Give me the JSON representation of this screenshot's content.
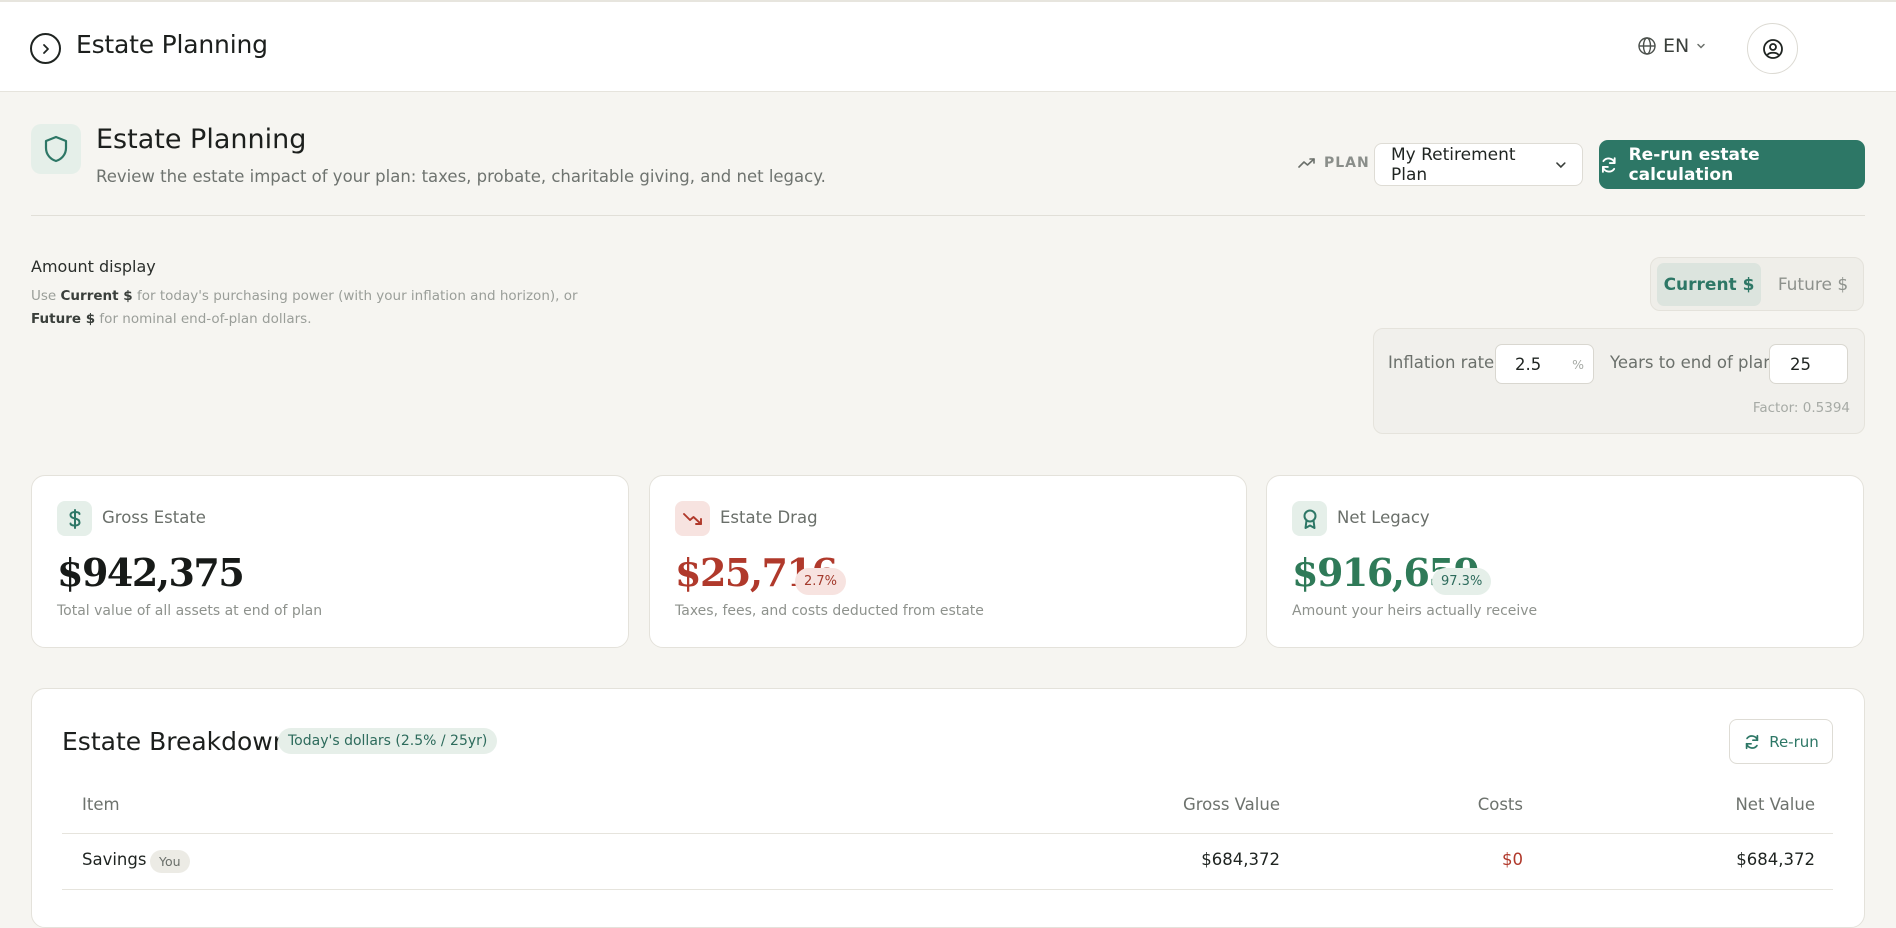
{
  "topbar": {
    "app_title": "Estate Planning",
    "language": "EN"
  },
  "header": {
    "title": "Estate Planning",
    "subtitle": "Review the estate impact of your plan: taxes, probate, charitable giving, and net legacy.",
    "plan_label": "PLAN",
    "plan_selected": "My Retirement Plan",
    "rerun_label": "Re-run estate calculation"
  },
  "amount_display": {
    "title": "Amount display",
    "desc_1": "Use ",
    "desc_current": "Current $",
    "desc_2": " for today's purchasing power (with your inflation and horizon), or ",
    "desc_future": "Future $",
    "desc_3": " for nominal end-of-plan dollars.",
    "toggle_current": "Current $",
    "toggle_future": "Future $",
    "toggle_active": "Current $",
    "inflation_label": "Inflation rate",
    "inflation_value": "2.5",
    "inflation_unit": "%",
    "years_label": "Years to end of plan",
    "years_value": "25",
    "factor": "Factor: 0.5394"
  },
  "cards": {
    "gross": {
      "label": "Gross Estate",
      "value": "$942,375",
      "sub": "Total value of all assets at end of plan"
    },
    "drag": {
      "label": "Estate Drag",
      "value": "$25,716",
      "pill": "2.7%",
      "sub": "Taxes, fees, and costs deducted from estate"
    },
    "net": {
      "label": "Net Legacy",
      "value": "$916,659",
      "pill": "97.3%",
      "sub": "Amount your heirs actually receive"
    }
  },
  "breakdown": {
    "title": "Estate Breakdown",
    "badge": "Today's dollars (2.5% / 25yr)",
    "rerun_label": "Re-run",
    "columns": {
      "item": "Item",
      "gross": "Gross Value",
      "costs": "Costs",
      "net": "Net Value"
    },
    "rows": [
      {
        "item": "Savings",
        "tag": "You",
        "gross": "$684,372",
        "costs": "$0",
        "net": "$684,372"
      }
    ]
  },
  "colors": {
    "accent": "#2d7766",
    "negative": "#b0392b",
    "positive": "#2f7a58"
  }
}
